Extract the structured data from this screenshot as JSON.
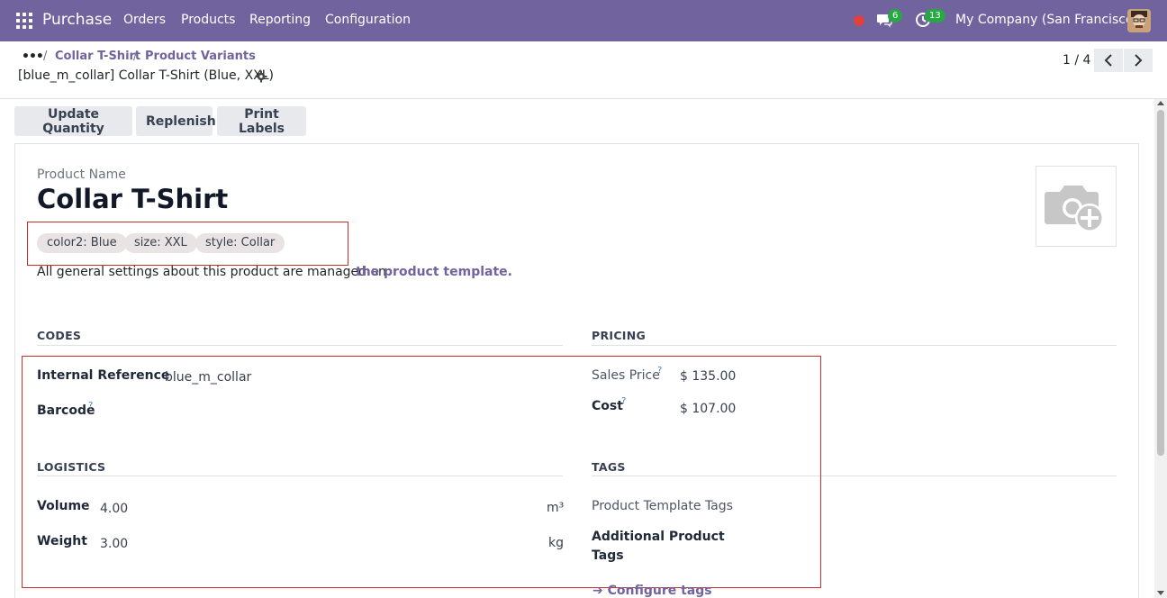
{
  "navbar": {
    "brand": "Purchase",
    "menu": [
      "Orders",
      "Products",
      "Reporting",
      "Configuration"
    ],
    "messages_count": "6",
    "activities_count": "13",
    "company": "My Company (San Francisco)",
    "bg_color": "#71639e"
  },
  "breadcrumb": {
    "dots": "•••",
    "items": [
      "Collar T-Shirt",
      "Product Variants"
    ],
    "separator": "/"
  },
  "record": {
    "title": "[blue_m_collar] Collar T-Shirt (Blue, XXL)",
    "pager": "1 / 4"
  },
  "actions": {
    "update_quantity": "Update Quantity",
    "replenish": "Replenish",
    "print_labels": "Print Labels"
  },
  "product": {
    "name_label": "Product Name",
    "name": "Collar T-Shirt",
    "attributes": [
      "color2: Blue",
      "size: XXL",
      "style: Collar"
    ],
    "general_text": "All general settings about this product are managed on",
    "template_link": "the product template."
  },
  "codes": {
    "title": "CODES",
    "internal_reference_label": "Internal Reference",
    "internal_reference": "blue_m_collar",
    "barcode_label": "Barcode",
    "help": "?"
  },
  "pricing": {
    "title": "PRICING",
    "sales_price_label": "Sales Price",
    "sales_price": "$ 135.00",
    "cost_label": "Cost",
    "cost": "$ 107.00"
  },
  "logistics": {
    "title": "LOGISTICS",
    "volume_label": "Volume",
    "volume": "4.00",
    "volume_unit": "m³",
    "weight_label": "Weight",
    "weight": "3.00",
    "weight_unit": "kg"
  },
  "tags": {
    "title": "TAGS",
    "template_tags_label": "Product Template Tags",
    "additional_label_1": "Additional Product",
    "additional_label_2": "Tags",
    "configure_link": "➔ Configure tags"
  },
  "colors": {
    "accent": "#71639e",
    "highlight_outline": "#c9302c"
  }
}
